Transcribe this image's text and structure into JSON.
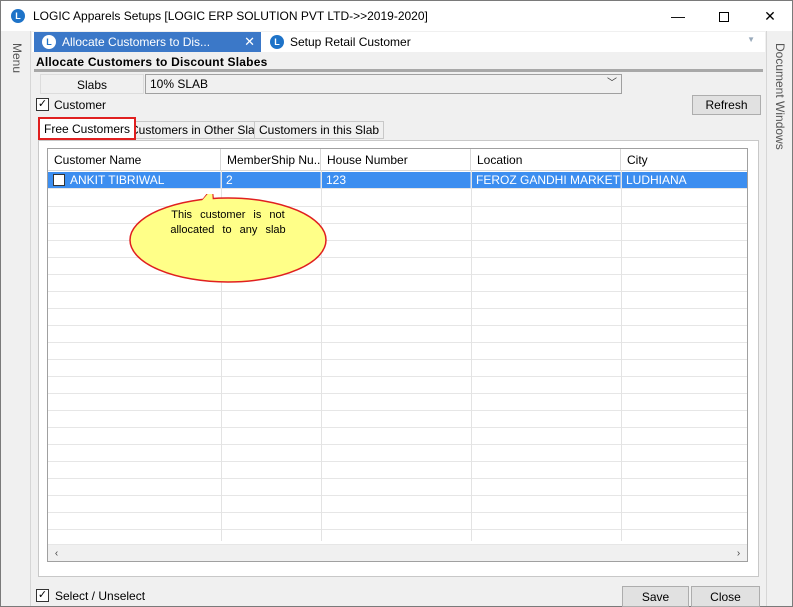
{
  "window": {
    "title": "LOGIC Apparels Setups  [LOGIC ERP SOLUTION PVT LTD->>2019-2020]",
    "minimize": "—",
    "close": "✕"
  },
  "left_dock": {
    "label": "Menu"
  },
  "right_dock": {
    "label": "Document Windows"
  },
  "doc_tabs": [
    {
      "label": "Allocate Customers to Dis...",
      "close": "✕"
    },
    {
      "label": "Setup Retail Customer"
    }
  ],
  "form": {
    "title": "Allocate Customers to Discount Slabes",
    "slabs_label": "Slabs",
    "slab_value": "10% SLAB",
    "customer_checkbox_label": "Customer",
    "customer_checked": true,
    "refresh_label": "Refresh"
  },
  "sub_tabs": [
    {
      "label": "Free Customers",
      "active": true
    },
    {
      "label": "Customers in Other Slabs"
    },
    {
      "label": "Customers in this Slab"
    }
  ],
  "grid": {
    "columns": [
      "Customer Name",
      "MemberShip Nu...",
      "House Number",
      "Location",
      "City"
    ],
    "rows": [
      {
        "checked": false,
        "name": "ANKIT  TIBRIWAL",
        "membership": "2",
        "house": "123",
        "location": "FEROZ GANDHI MARKET",
        "city": "LUDHIANA"
      }
    ]
  },
  "callout": {
    "line1": "This customer is not",
    "line2": "allocated to any slab",
    "fill_color": "#ffff88",
    "border_color": "#e02020"
  },
  "footer": {
    "select_label": "Select / Unselect",
    "select_checked": true,
    "save_label": "Save",
    "close_label": "Close"
  },
  "colors": {
    "active_tab": "#3b78c8",
    "selected_row": "#3c8ef0",
    "highlight_border": "#e02020"
  }
}
